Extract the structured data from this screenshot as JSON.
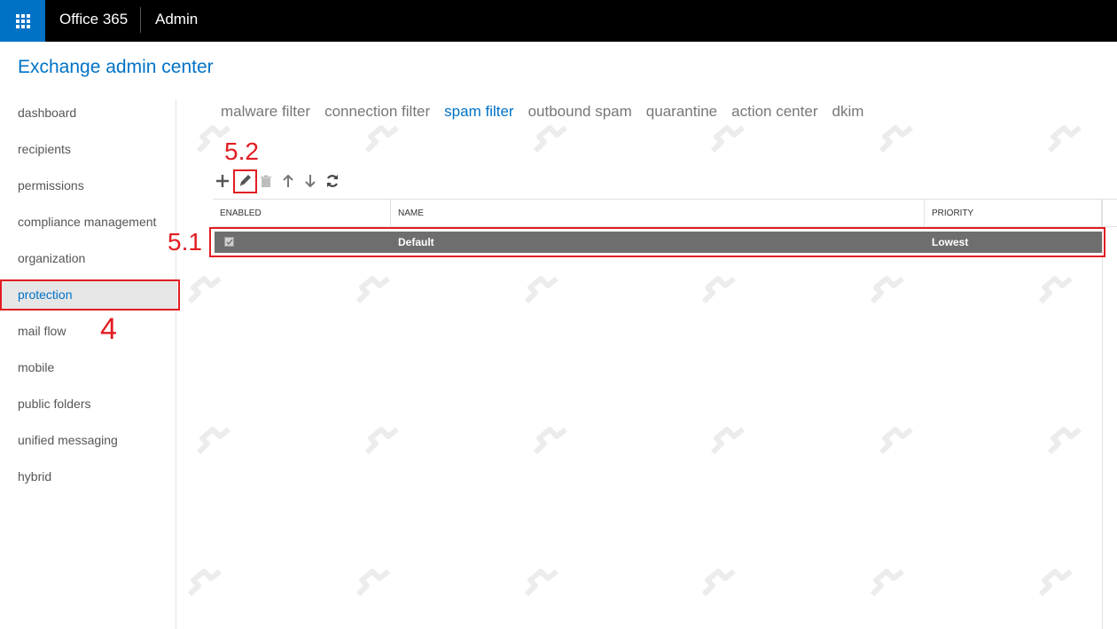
{
  "topbar": {
    "app_name": "Office 365",
    "section_name": "Admin",
    "waffle_icon": "app-launcher-icon"
  },
  "header": {
    "title": "Exchange admin center"
  },
  "sidebar": {
    "items": [
      {
        "label": "dashboard"
      },
      {
        "label": "recipients"
      },
      {
        "label": "permissions"
      },
      {
        "label": "compliance management"
      },
      {
        "label": "organization"
      },
      {
        "label": "protection",
        "active": true
      },
      {
        "label": "mail flow"
      },
      {
        "label": "mobile"
      },
      {
        "label": "public folders"
      },
      {
        "label": "unified messaging"
      },
      {
        "label": "hybrid"
      }
    ]
  },
  "tabs": [
    {
      "label": "malware filter"
    },
    {
      "label": "connection filter"
    },
    {
      "label": "spam filter",
      "active": true
    },
    {
      "label": "outbound spam"
    },
    {
      "label": "quarantine"
    },
    {
      "label": "action center"
    },
    {
      "label": "dkim"
    }
  ],
  "toolbar": {
    "icons": [
      "add-icon",
      "edit-icon",
      "delete-icon",
      "move-up-icon",
      "move-down-icon",
      "refresh-icon"
    ]
  },
  "table": {
    "columns": [
      "ENABLED",
      "NAME",
      "PRIORITY"
    ],
    "rows": [
      {
        "enabled": true,
        "name": "Default",
        "priority": "Lowest"
      }
    ]
  },
  "annotations": {
    "step_nav": "4",
    "step_row": "5.1",
    "step_edit": "5.2",
    "color": "#e21d23"
  },
  "colors": {
    "accent": "#0072c6",
    "topbar": "#000000",
    "selected_row": "#6e6e6e"
  }
}
